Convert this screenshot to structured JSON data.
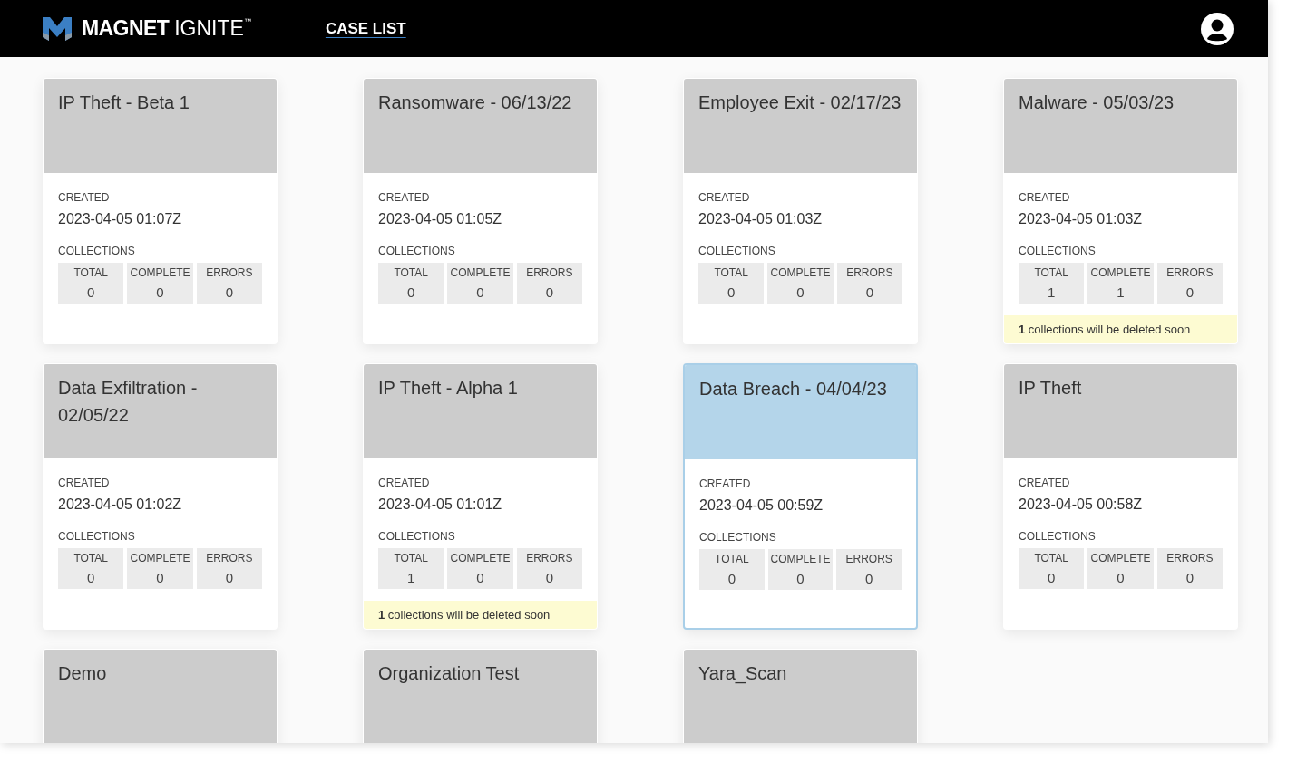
{
  "header": {
    "logo_text": "MAGNET",
    "logo_text_light": "IGNITE",
    "trademark": "™",
    "nav_link": "CASE LIST"
  },
  "cases": [
    {
      "title": "IP Theft - Beta 1",
      "selected": false,
      "created_label": "CREATED",
      "created": "2023-04-05 01:07Z",
      "collections_label": "COLLECTIONS",
      "stats": [
        {
          "label": "TOTAL",
          "value": "0"
        },
        {
          "label": "COMPLETE",
          "value": "0"
        },
        {
          "label": "ERRORS",
          "value": "0"
        }
      ]
    },
    {
      "title": "Ransomware - 06/13/22",
      "selected": false,
      "created_label": "CREATED",
      "created": "2023-04-05 01:05Z",
      "collections_label": "COLLECTIONS",
      "stats": [
        {
          "label": "TOTAL",
          "value": "0"
        },
        {
          "label": "COMPLETE",
          "value": "0"
        },
        {
          "label": "ERRORS",
          "value": "0"
        }
      ]
    },
    {
      "title": "Employee Exit - 02/17/23",
      "selected": false,
      "created_label": "CREATED",
      "created": "2023-04-05 01:03Z",
      "collections_label": "COLLECTIONS",
      "stats": [
        {
          "label": "TOTAL",
          "value": "0"
        },
        {
          "label": "COMPLETE",
          "value": "0"
        },
        {
          "label": "ERRORS",
          "value": "0"
        }
      ]
    },
    {
      "title": "Malware - 05/03/23",
      "selected": false,
      "created_label": "CREATED",
      "created": "2023-04-05 01:03Z",
      "collections_label": "COLLECTIONS",
      "stats": [
        {
          "label": "TOTAL",
          "value": "1"
        },
        {
          "label": "COMPLETE",
          "value": "1"
        },
        {
          "label": "ERRORS",
          "value": "0"
        }
      ],
      "notice": "**1** collections will be deleted soon"
    },
    {
      "title": "Data Exfiltration - 02/05/22",
      "selected": false,
      "created_label": "CREATED",
      "created": "2023-04-05 01:02Z",
      "collections_label": "COLLECTIONS",
      "stats": [
        {
          "label": "TOTAL",
          "value": "0"
        },
        {
          "label": "COMPLETE",
          "value": "0"
        },
        {
          "label": "ERRORS",
          "value": "0"
        }
      ]
    },
    {
      "title": "IP Theft - Alpha 1",
      "selected": false,
      "created_label": "CREATED",
      "created": "2023-04-05 01:01Z",
      "collections_label": "COLLECTIONS",
      "stats": [
        {
          "label": "TOTAL",
          "value": "1"
        },
        {
          "label": "COMPLETE",
          "value": "0"
        },
        {
          "label": "ERRORS",
          "value": "0"
        }
      ],
      "notice": "**1** collections will be deleted soon"
    },
    {
      "title": "Data Breach - 04/04/23",
      "selected": true,
      "created_label": "CREATED",
      "created": "2023-04-05 00:59Z",
      "collections_label": "COLLECTIONS",
      "stats": [
        {
          "label": "TOTAL",
          "value": "0"
        },
        {
          "label": "COMPLETE",
          "value": "0"
        },
        {
          "label": "ERRORS",
          "value": "0"
        }
      ]
    },
    {
      "title": "IP Theft",
      "selected": false,
      "created_label": "CREATED",
      "created": "2023-04-05 00:58Z",
      "collections_label": "COLLECTIONS",
      "stats": [
        {
          "label": "TOTAL",
          "value": "0"
        },
        {
          "label": "COMPLETE",
          "value": "0"
        },
        {
          "label": "ERRORS",
          "value": "0"
        }
      ]
    },
    {
      "title": "Demo",
      "selected": false
    },
    {
      "title": "Organization Test",
      "selected": false
    },
    {
      "title": "Yara_Scan",
      "selected": false
    }
  ]
}
